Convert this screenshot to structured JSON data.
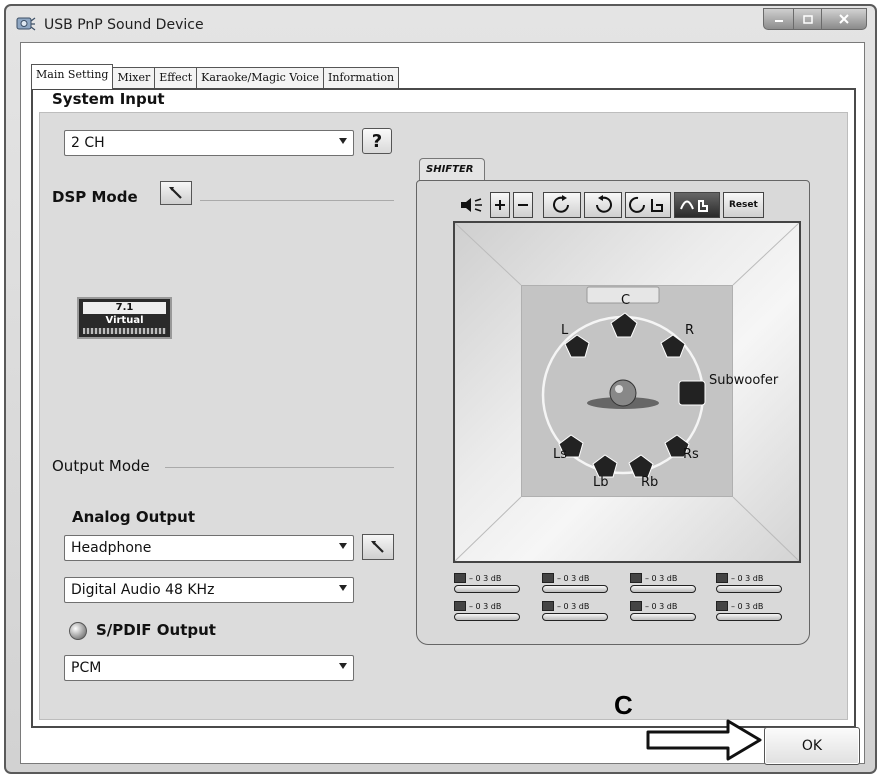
{
  "window": {
    "title": "USB PnP Sound Device",
    "controls": [
      "minimize",
      "maximize",
      "close"
    ]
  },
  "tabs": [
    {
      "label": "Main Setting",
      "active": true
    },
    {
      "label": "Mixer",
      "active": false
    },
    {
      "label": "Effect",
      "active": false
    },
    {
      "label": "Karaoke/Magic Voice",
      "active": false
    },
    {
      "label": "Information",
      "active": false
    }
  ],
  "main": {
    "system_input": {
      "title": "System Input",
      "channel_select": "2 CH",
      "help_label": "?"
    },
    "dsp_mode": {
      "label": "DSP Mode"
    },
    "virtual_badge": {
      "line1": "7.1",
      "line2": "Virtual"
    },
    "output_mode": {
      "title": "Output Mode",
      "analog_title": "Analog Output",
      "analog_select": "Headphone",
      "sample_rate_select": "Digital Audio 48 KHz",
      "spdif_label": "S/PDIF Output",
      "spdif_select": "PCM"
    }
  },
  "shifter": {
    "tab_label": "SHIFTER",
    "reset_label": "Reset",
    "toolbar_icons": [
      "speaker-icon",
      "plus-icon",
      "minus-icon",
      "rotate-cw-icon",
      "rotate-ccw-icon",
      "rotate-headphone-icon",
      "hand-icon"
    ],
    "speakers": {
      "c": "C",
      "l": "L",
      "r": "R",
      "sub": "Subwoofer",
      "ls": "Ls",
      "rs": "Rs",
      "lb": "Lb",
      "rb": "Rb"
    },
    "meters": [
      {
        "id": "L",
        "text": "– 0 3 dB"
      },
      {
        "id": "C",
        "text": "– 0 3 dB"
      },
      {
        "id": "R",
        "text": "– 0 3 dB"
      },
      {
        "id": "Lb",
        "text": "– 0 3 dB"
      },
      {
        "id": "Ls",
        "text": "– 0 3 dB"
      },
      {
        "id": "Sub",
        "text": "– 0 3 dB"
      },
      {
        "id": "Rs",
        "text": "– 0 3 dB"
      },
      {
        "id": "Rb",
        "text": "– 0 3 dB"
      }
    ]
  },
  "footer": {
    "ok_label": "OK",
    "callout_label": "C"
  }
}
